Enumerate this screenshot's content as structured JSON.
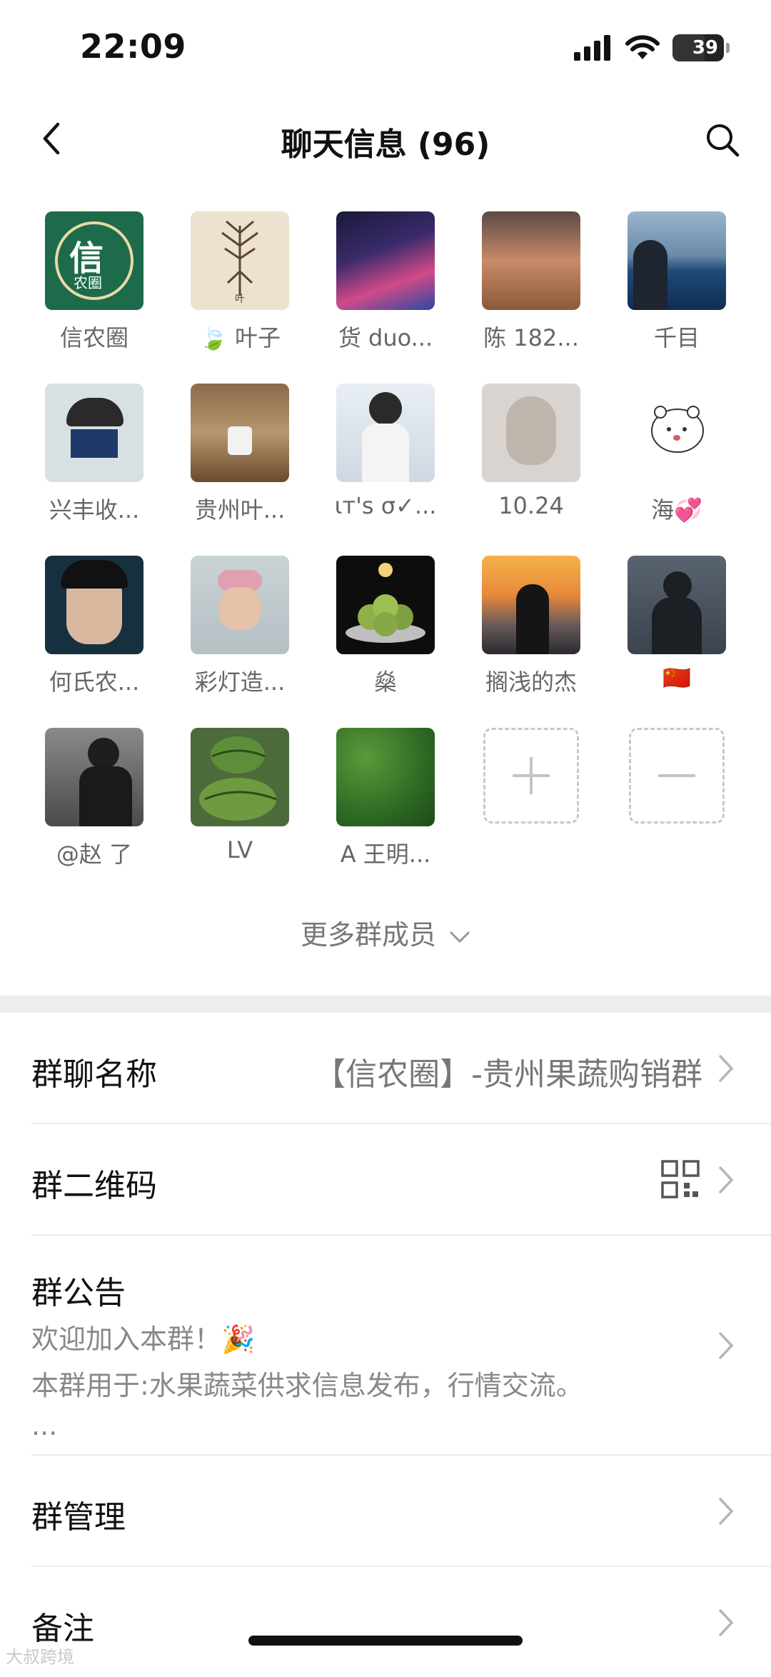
{
  "status": {
    "time": "22:09",
    "battery": "39"
  },
  "nav": {
    "title": "聊天信息 (96)"
  },
  "members": [
    {
      "name": "信农圈"
    },
    {
      "name": "🍃 叶子"
    },
    {
      "name": "货 duo..."
    },
    {
      "name": "陈 182..."
    },
    {
      "name": "千目"
    },
    {
      "name": "兴丰收..."
    },
    {
      "name": "贵州叶..."
    },
    {
      "name": "ιт's σ✓..."
    },
    {
      "name": "10.24"
    },
    {
      "name": "海💞"
    },
    {
      "name": "何氏农..."
    },
    {
      "name": "彩灯造..."
    },
    {
      "name": "燊"
    },
    {
      "name": "搁浅的杰"
    },
    {
      "name": "🇨🇳"
    },
    {
      "name": "@赵 了"
    },
    {
      "name": "LV"
    },
    {
      "name": "A 王明..."
    }
  ],
  "avatar_logo": {
    "big": "信",
    "small": "农圈"
  },
  "avatar_leaf_caption": "叶",
  "more_members": "更多群成员",
  "settings": {
    "group_name_label": "群聊名称",
    "group_name_value": "【信农圈】-贵州果蔬购销群",
    "qr_label": "群二维码",
    "notice_label": "群公告",
    "notice_line1": "欢迎加入本群！🎉",
    "notice_line2": "本群用于:水果蔬菜供求信息发布，行情交流。",
    "notice_line3": "...",
    "manage_label": "群管理",
    "remark_label": "备注"
  },
  "watermark": "大叔跨境"
}
